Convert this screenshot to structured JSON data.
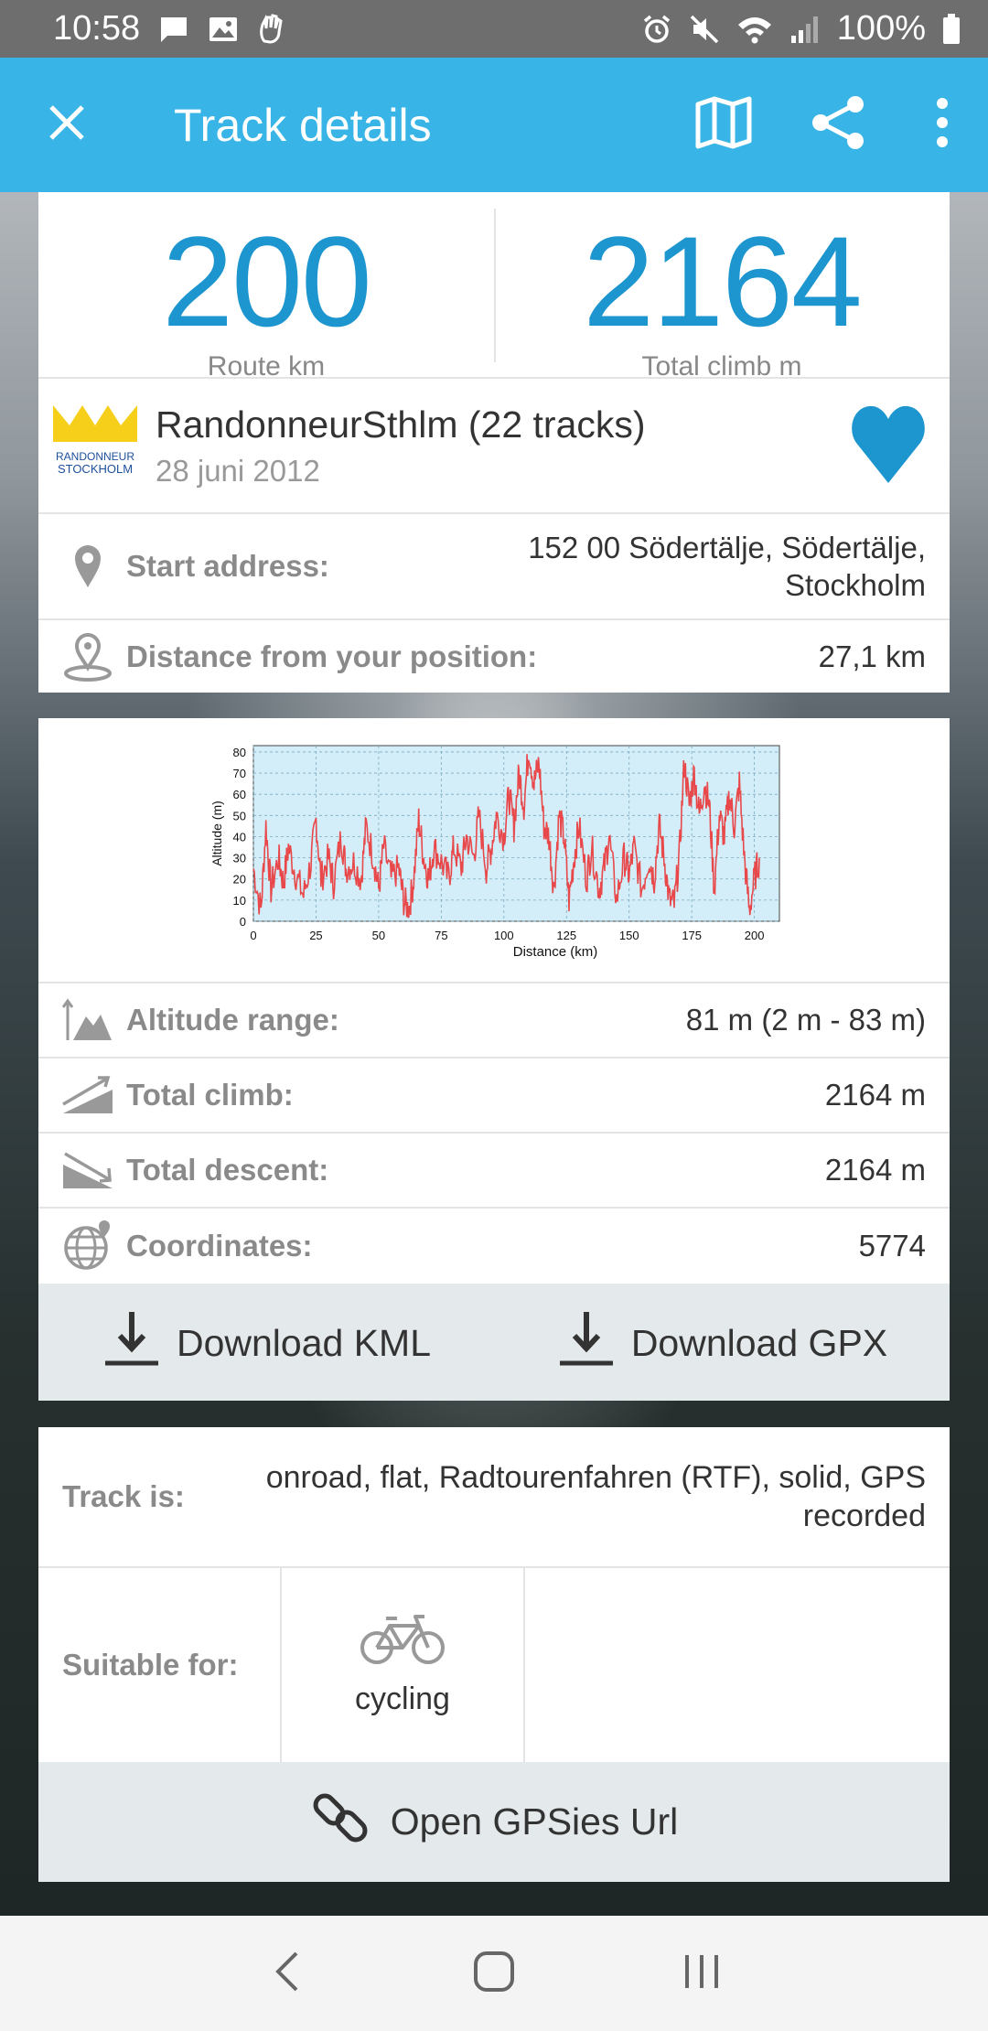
{
  "status_bar": {
    "time": "10:58",
    "battery": "100%"
  },
  "app_bar": {
    "title": "Track details",
    "icons": [
      "close-icon",
      "map-icon",
      "share-icon",
      "more-vert-icon"
    ]
  },
  "summary": {
    "route_km": "200",
    "route_km_label": "Route km",
    "total_climb": "2164",
    "total_climb_label": "Total climb m"
  },
  "author": {
    "logo_text_line1": "RANDONNEUR",
    "logo_text_line2": "STOCKHOLM",
    "name": "RandonneurSthlm (22 tracks)",
    "date": "28 juni 2012"
  },
  "location": {
    "start_label": "Start address:",
    "start_value_line1": "152 00 Södertälje, Södertälje,",
    "start_value_line2": "Stockholm",
    "distance_label": "Distance from your position:",
    "distance_value": "27,1 km"
  },
  "chart_data": {
    "type": "line",
    "xlabel": "Distance (km)",
    "ylabel": "Altitude (m)",
    "xlim": [
      0,
      210
    ],
    "ylim": [
      0,
      83
    ],
    "xticks": [
      0,
      25,
      50,
      75,
      100,
      125,
      150,
      175,
      200
    ],
    "yticks": [
      0,
      10,
      20,
      30,
      40,
      50,
      60,
      70,
      80
    ],
    "grid": true,
    "color": "#e8484a",
    "x": [
      0,
      3,
      5,
      7,
      10,
      12,
      14,
      17,
      20,
      23,
      25,
      27,
      30,
      32,
      35,
      37,
      40,
      43,
      45,
      48,
      50,
      52,
      55,
      58,
      60,
      62,
      64,
      66,
      68,
      70,
      72,
      75,
      78,
      80,
      83,
      85,
      88,
      90,
      93,
      95,
      97,
      100,
      102,
      104,
      106,
      108,
      110,
      112,
      114,
      116,
      118,
      120,
      122,
      124,
      126,
      128,
      130,
      133,
      135,
      138,
      140,
      142,
      145,
      148,
      150,
      152,
      155,
      158,
      160,
      162,
      164,
      166,
      168,
      170,
      172,
      174,
      176,
      178,
      180,
      182,
      184,
      186,
      188,
      190,
      192,
      194,
      196,
      198,
      200,
      202
    ],
    "y": [
      25,
      5,
      45,
      15,
      30,
      18,
      35,
      22,
      12,
      28,
      48,
      20,
      30,
      18,
      40,
      25,
      28,
      20,
      45,
      30,
      15,
      35,
      20,
      25,
      10,
      5,
      20,
      48,
      30,
      20,
      35,
      28,
      20,
      35,
      25,
      40,
      30,
      50,
      25,
      35,
      50,
      40,
      60,
      45,
      70,
      55,
      82,
      65,
      75,
      45,
      40,
      15,
      50,
      40,
      10,
      30,
      45,
      20,
      35,
      15,
      25,
      40,
      10,
      30,
      22,
      35,
      15,
      30,
      20,
      45,
      30,
      10,
      8,
      30,
      75,
      55,
      70,
      50,
      65,
      55,
      15,
      50,
      40,
      60,
      45,
      65,
      30,
      5,
      20,
      30
    ]
  },
  "stats": {
    "altitude_label": "Altitude range:",
    "altitude_value": "81 m (2 m - 83 m)",
    "climb_label": "Total climb:",
    "climb_value": "2164 m",
    "descent_label": "Total descent:",
    "descent_value": "2164 m",
    "coords_label": "Coordinates:",
    "coords_value": "5774"
  },
  "downloads": {
    "kml": "Download KML",
    "gpx": "Download GPX"
  },
  "track": {
    "label": "Track is:",
    "value_line1": "onroad, flat, Radtourenfahren (RTF), solid, GPS",
    "value_line2": "recorded"
  },
  "suitable": {
    "label": "Suitable for:",
    "item": "cycling"
  },
  "open_url": "Open GPSies Url"
}
